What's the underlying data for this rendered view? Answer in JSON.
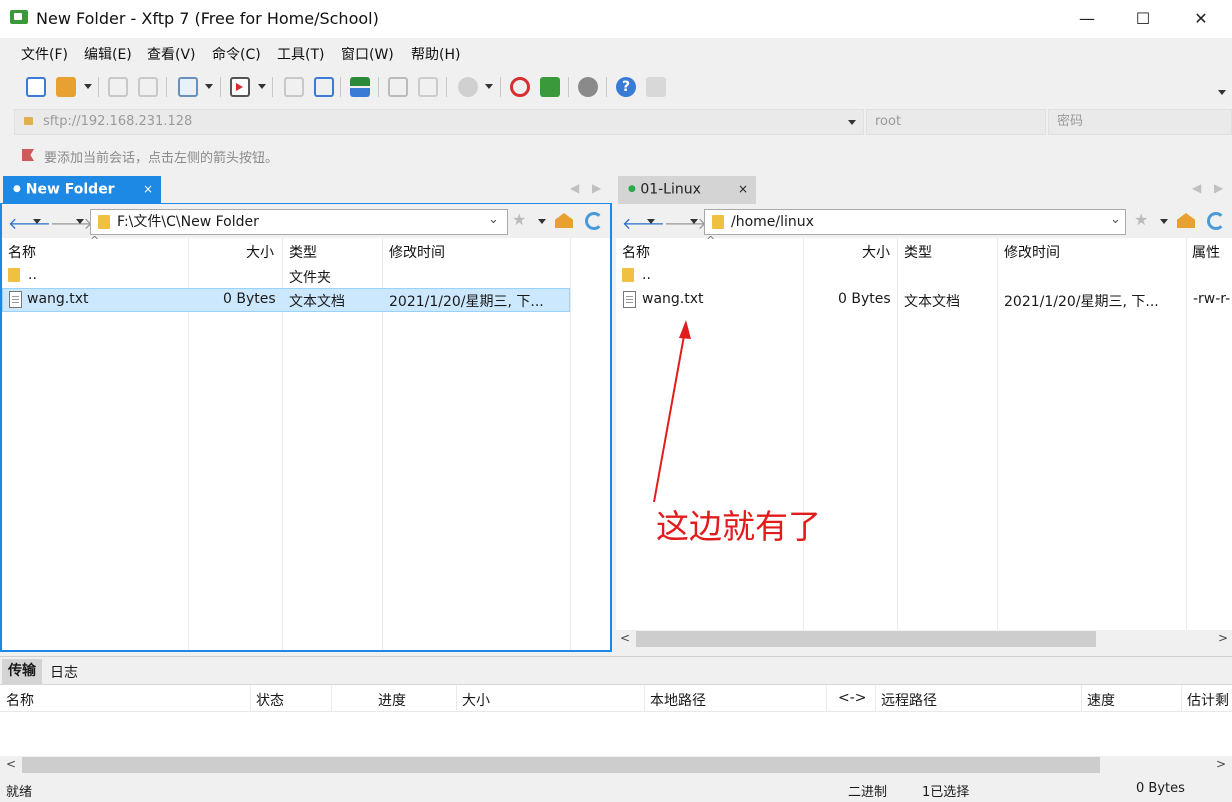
{
  "window": {
    "title": "New Folder - Xftp 7 (Free for Home/School)",
    "minimize": "—",
    "maximize": "☐",
    "close": "✕"
  },
  "menu": [
    "文件(F)",
    "编辑(E)",
    "查看(V)",
    "命令(C)",
    "工具(T)",
    "窗口(W)",
    "帮助(H)"
  ],
  "address": {
    "host": "sftp://192.168.231.128",
    "user": "root",
    "password_placeholder": "密码"
  },
  "hint": "要添加当前会话，点击左侧的箭头按钮。",
  "left_panel": {
    "tab_label": "New Folder",
    "path": "F:\\文件\\C\\New Folder",
    "columns": [
      "名称",
      "大小",
      "类型",
      "修改时间"
    ],
    "rows": [
      {
        "name": "..",
        "size": "",
        "type": "文件夹",
        "modified": ""
      },
      {
        "name": "wang.txt",
        "size": "0 Bytes",
        "type": "文本文档",
        "modified": "2021/1/20/星期三, 下..."
      }
    ]
  },
  "right_panel": {
    "tab_label": "01-Linux",
    "path": "/home/linux",
    "columns": [
      "名称",
      "大小",
      "类型",
      "修改时间",
      "属性"
    ],
    "rows": [
      {
        "name": "..",
        "size": "",
        "type": "",
        "modified": "",
        "attr": ""
      },
      {
        "name": "wang.txt",
        "size": "0 Bytes",
        "type": "文本文档",
        "modified": "2021/1/20/星期三, 下...",
        "attr": "-rw-r-"
      }
    ]
  },
  "annotation": "这边就有了",
  "bottom_tabs": [
    "传输",
    "日志"
  ],
  "transfer_columns": [
    "名称",
    "状态",
    "进度",
    "大小",
    "本地路径",
    "<->",
    "远程路径",
    "速度",
    "估计剩"
  ],
  "status": {
    "ready": "就绪",
    "mode": "二进制",
    "selected": "1已选择",
    "size": "0 Bytes"
  },
  "colors": {
    "accent": "#1e88e5",
    "selection": "#cce8ff",
    "annotation": "#e21c1c"
  }
}
